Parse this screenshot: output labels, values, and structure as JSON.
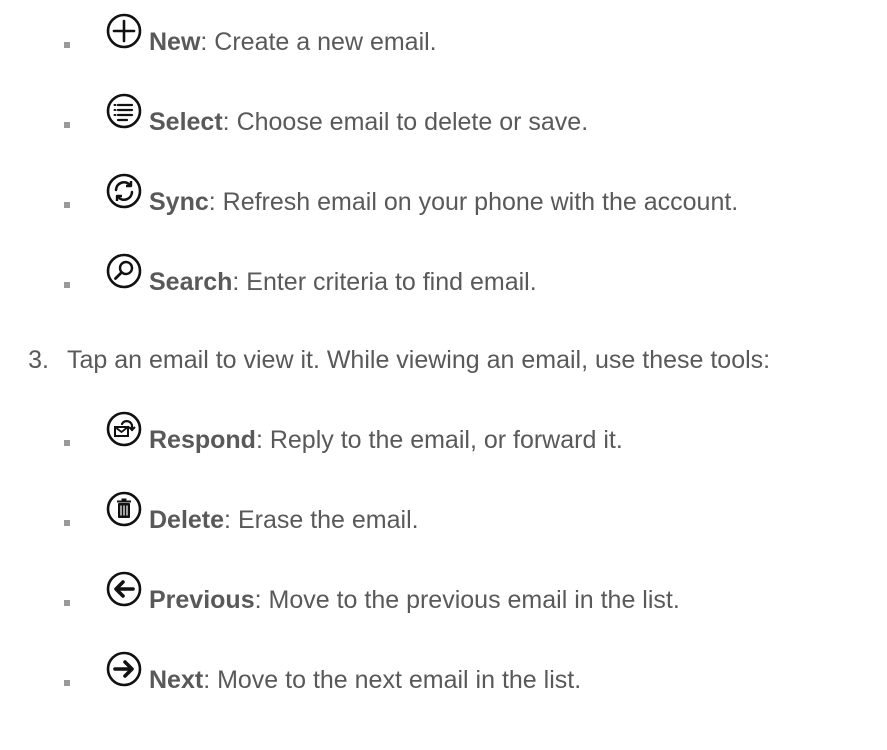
{
  "list1": [
    {
      "term": "New",
      "desc": ": Create a new email.",
      "icon": "plus-circle-icon"
    },
    {
      "term": "Select",
      "desc": ": Choose email to delete or save.",
      "icon": "list-circle-icon"
    },
    {
      "term": "Sync",
      "desc": ": Refresh email on your phone with the account.",
      "icon": "sync-circle-icon"
    },
    {
      "term": "Search",
      "desc": ": Enter criteria to find email.",
      "icon": "search-circle-icon"
    }
  ],
  "step": {
    "number": "3.",
    "text": "Tap an email to view it. While viewing an email, use these tools:"
  },
  "list2": [
    {
      "term": "Respond",
      "desc": ": Reply to the email, or forward it.",
      "icon": "respond-circle-icon"
    },
    {
      "term": "Delete",
      "desc": ": Erase the email.",
      "icon": "trash-circle-icon"
    },
    {
      "term": "Previous",
      "desc": ": Move to the previous email in the list.",
      "icon": "arrow-left-circle-icon"
    },
    {
      "term": "Next",
      "desc": ": Move to the next email in the list.",
      "icon": "arrow-right-circle-icon"
    }
  ]
}
